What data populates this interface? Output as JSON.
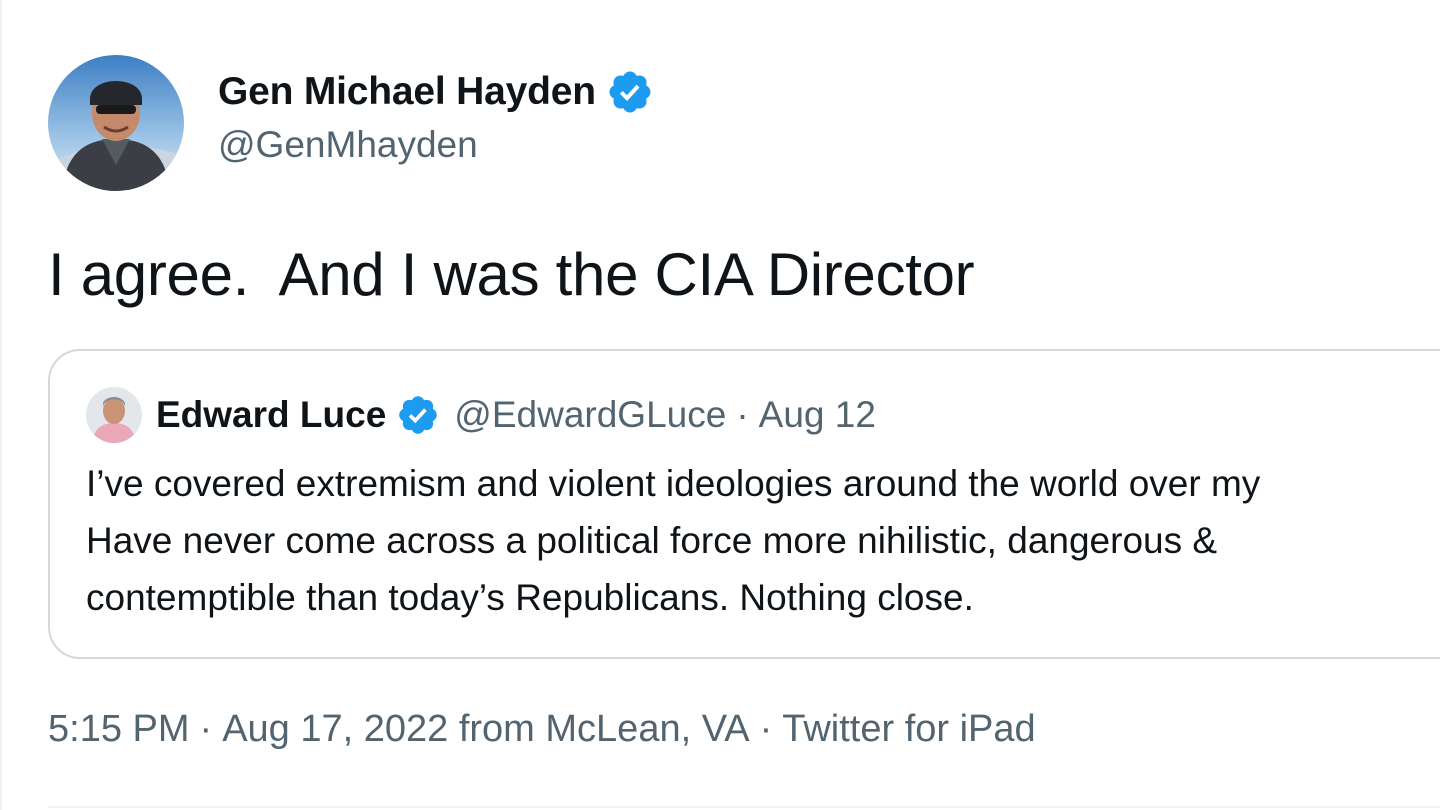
{
  "author": {
    "display_name": "Gen Michael Hayden",
    "handle": "@GenMhayden",
    "verified": true
  },
  "tweet": {
    "text": "I agree.  And I was the CIA Director"
  },
  "quoted_tweet": {
    "author_name": "Edward Luce",
    "handle": "@EdwardGLuce",
    "separator": "·",
    "date": "Aug 12",
    "verified": true,
    "lines": [
      "I’ve covered extremism and violent ideologies around the world over my",
      "Have never come across a political force more nihilistic, dangerous &",
      "contemptible than today’s Republicans. Nothing close."
    ]
  },
  "meta": {
    "time": "5:15 PM",
    "separator": "·",
    "date_location": "Aug 17, 2022 from McLean, VA",
    "source": "Twitter for iPad"
  },
  "colors": {
    "verified_blue": "#1d9bf0",
    "secondary_text": "#536471",
    "border": "#cfd9de"
  },
  "icons": {
    "verified": "verified-badge-icon"
  }
}
